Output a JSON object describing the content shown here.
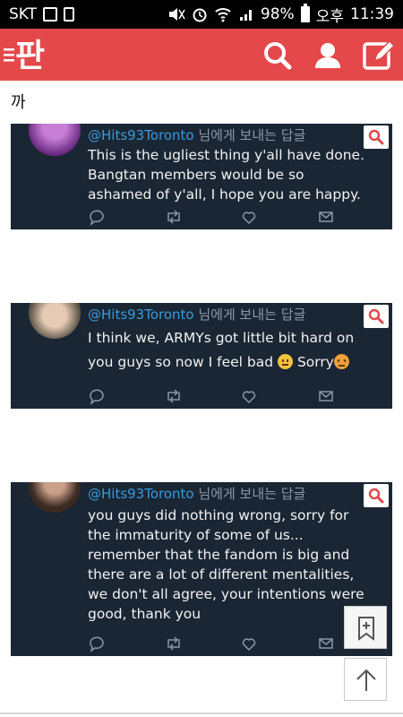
{
  "status_bar": {
    "carrier": "SKT",
    "battery": "98%",
    "ampm": "오후",
    "time": "11:39"
  },
  "header": {
    "logo_text": "판",
    "brand_color": "#e4484a"
  },
  "post": {
    "first_line": "까"
  },
  "tweets": [
    {
      "handle": "@Hits93Toronto",
      "reply_suffix": " 님에게 보내는 답글",
      "lines": [
        "This is the ugliest thing y'all have done.",
        "Bangtan members would be so",
        "ashamed of y'all, I hope you are happy."
      ]
    },
    {
      "handle": "@Hits93Toronto",
      "reply_suffix": " 님에게 보내는 답글",
      "lines": [
        "I think we, ARMYs got little bit hard on",
        "you guys so now I feel bad",
        "Sorry"
      ]
    },
    {
      "handle": "@Hits93Toronto",
      "reply_suffix": " 님에게 보내는 답글",
      "lines": [
        "you guys did nothing wrong, sorry for",
        "the immaturity of some of us...",
        "remember that the fandom is big and",
        "there are a lot of different mentalities,",
        "we don't all agree, your intentions were",
        "good, thank you"
      ]
    }
  ],
  "icons": [
    "menu-icon",
    "search-icon",
    "user-icon",
    "write-icon",
    "zoom-search-icon",
    "reply-icon",
    "retweet-icon",
    "like-icon",
    "message-icon",
    "bookmark-icon",
    "scroll-top-icon"
  ]
}
